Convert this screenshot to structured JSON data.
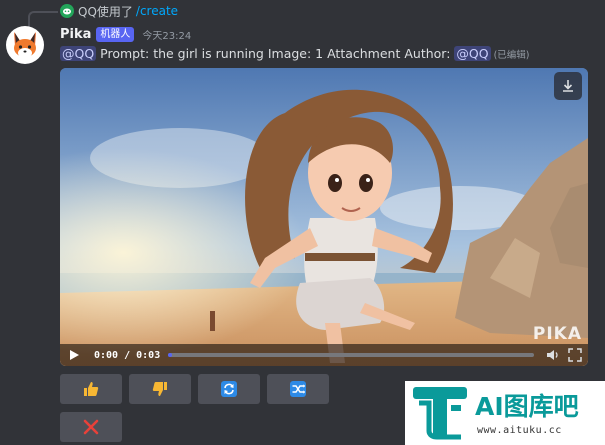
{
  "reply": {
    "user": "QQ使用了",
    "command": "/create"
  },
  "message": {
    "author": "Pika",
    "bot_badge": "机器人",
    "timestamp": "今天23:24",
    "mention": "@QQ",
    "text": " Prompt: the girl is running  Image: 1 Attachment  Author: ",
    "author_mention": "@QQ",
    "edited": "(已编辑)"
  },
  "video": {
    "watermark": "PIKA",
    "time": "0:00 / 0:03",
    "progress": 0.01
  },
  "icons": {
    "download": "download-icon",
    "play": "play-icon",
    "volume": "volume-icon",
    "fullscreen": "fullscreen-icon",
    "thumbs_up": "thumbs-up-icon",
    "thumbs_down": "thumbs-down-icon",
    "refresh": "refresh-icon",
    "shuffle": "shuffle-icon",
    "cancel": "cross-icon"
  },
  "colors": {
    "background": "#313338",
    "blurple": "#5865f2",
    "button": "#4e5058",
    "thumb": "#f7b733",
    "action_blue": "#2d8ae6",
    "cancel_red": "#e8413a",
    "ad_teal": "#0a9a9a"
  },
  "ad": {
    "brand": "AI图库吧",
    "site": "www.aituku.cc"
  }
}
